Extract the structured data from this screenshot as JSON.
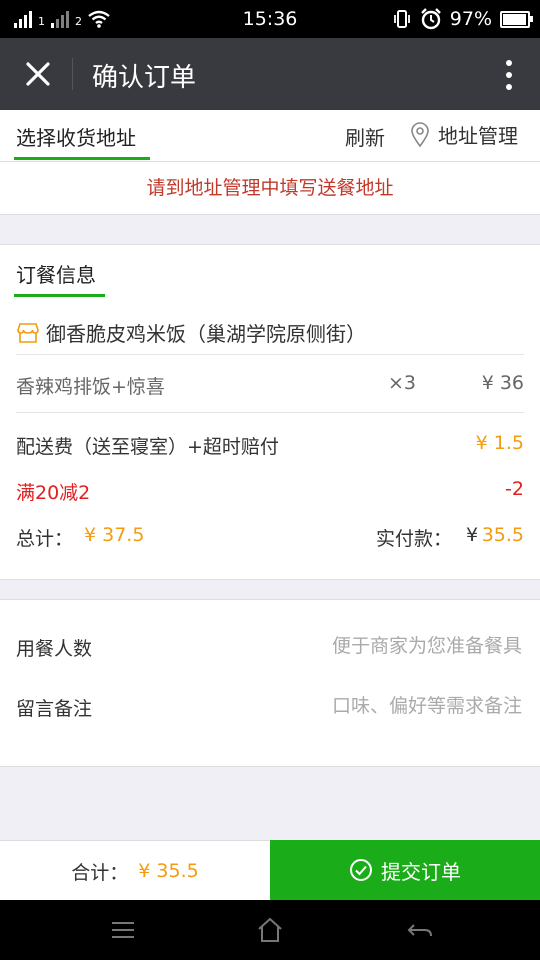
{
  "status_bar": {
    "time": "15:36",
    "battery": "97%",
    "sim1": "1",
    "sim2": "2"
  },
  "title_bar": {
    "title": "确认订单"
  },
  "address": {
    "tab_label": "选择收货地址",
    "refresh_label": "刷新",
    "manage_label": "地址管理",
    "notice": "请到地址管理中填写送餐地址"
  },
  "order": {
    "section_title": "订餐信息",
    "shop_name": "御香脆皮鸡米饭（巢湖学院原侧街）",
    "items": [
      {
        "name": "香辣鸡排饭+惊喜",
        "qty": "×3",
        "price": "¥ 36"
      }
    ],
    "delivery_fee_label": "配送费（送至寝室）+超时赔付",
    "delivery_fee_value": "¥ 1.5",
    "promo_label": "满20减2",
    "promo_value": "-2",
    "total_label": "总计：",
    "total_value": "¥ 37.5",
    "paid_label": "实付款：",
    "paid_currency": "¥",
    "paid_value": "35.5"
  },
  "extra": {
    "diners_label": "用餐人数",
    "diners_placeholder": "便于商家为您准备餐具",
    "remark_label": "留言备注",
    "remark_placeholder": "口味、偏好等需求备注"
  },
  "footer": {
    "sum_label": "合计：",
    "sum_value": "¥ 35.5",
    "submit_label": "提交订单"
  },
  "colors": {
    "accent_green": "#1aad19",
    "price_orange": "#f39c12",
    "alert_red": "#e02020",
    "titlebar_bg": "#393a3f"
  }
}
